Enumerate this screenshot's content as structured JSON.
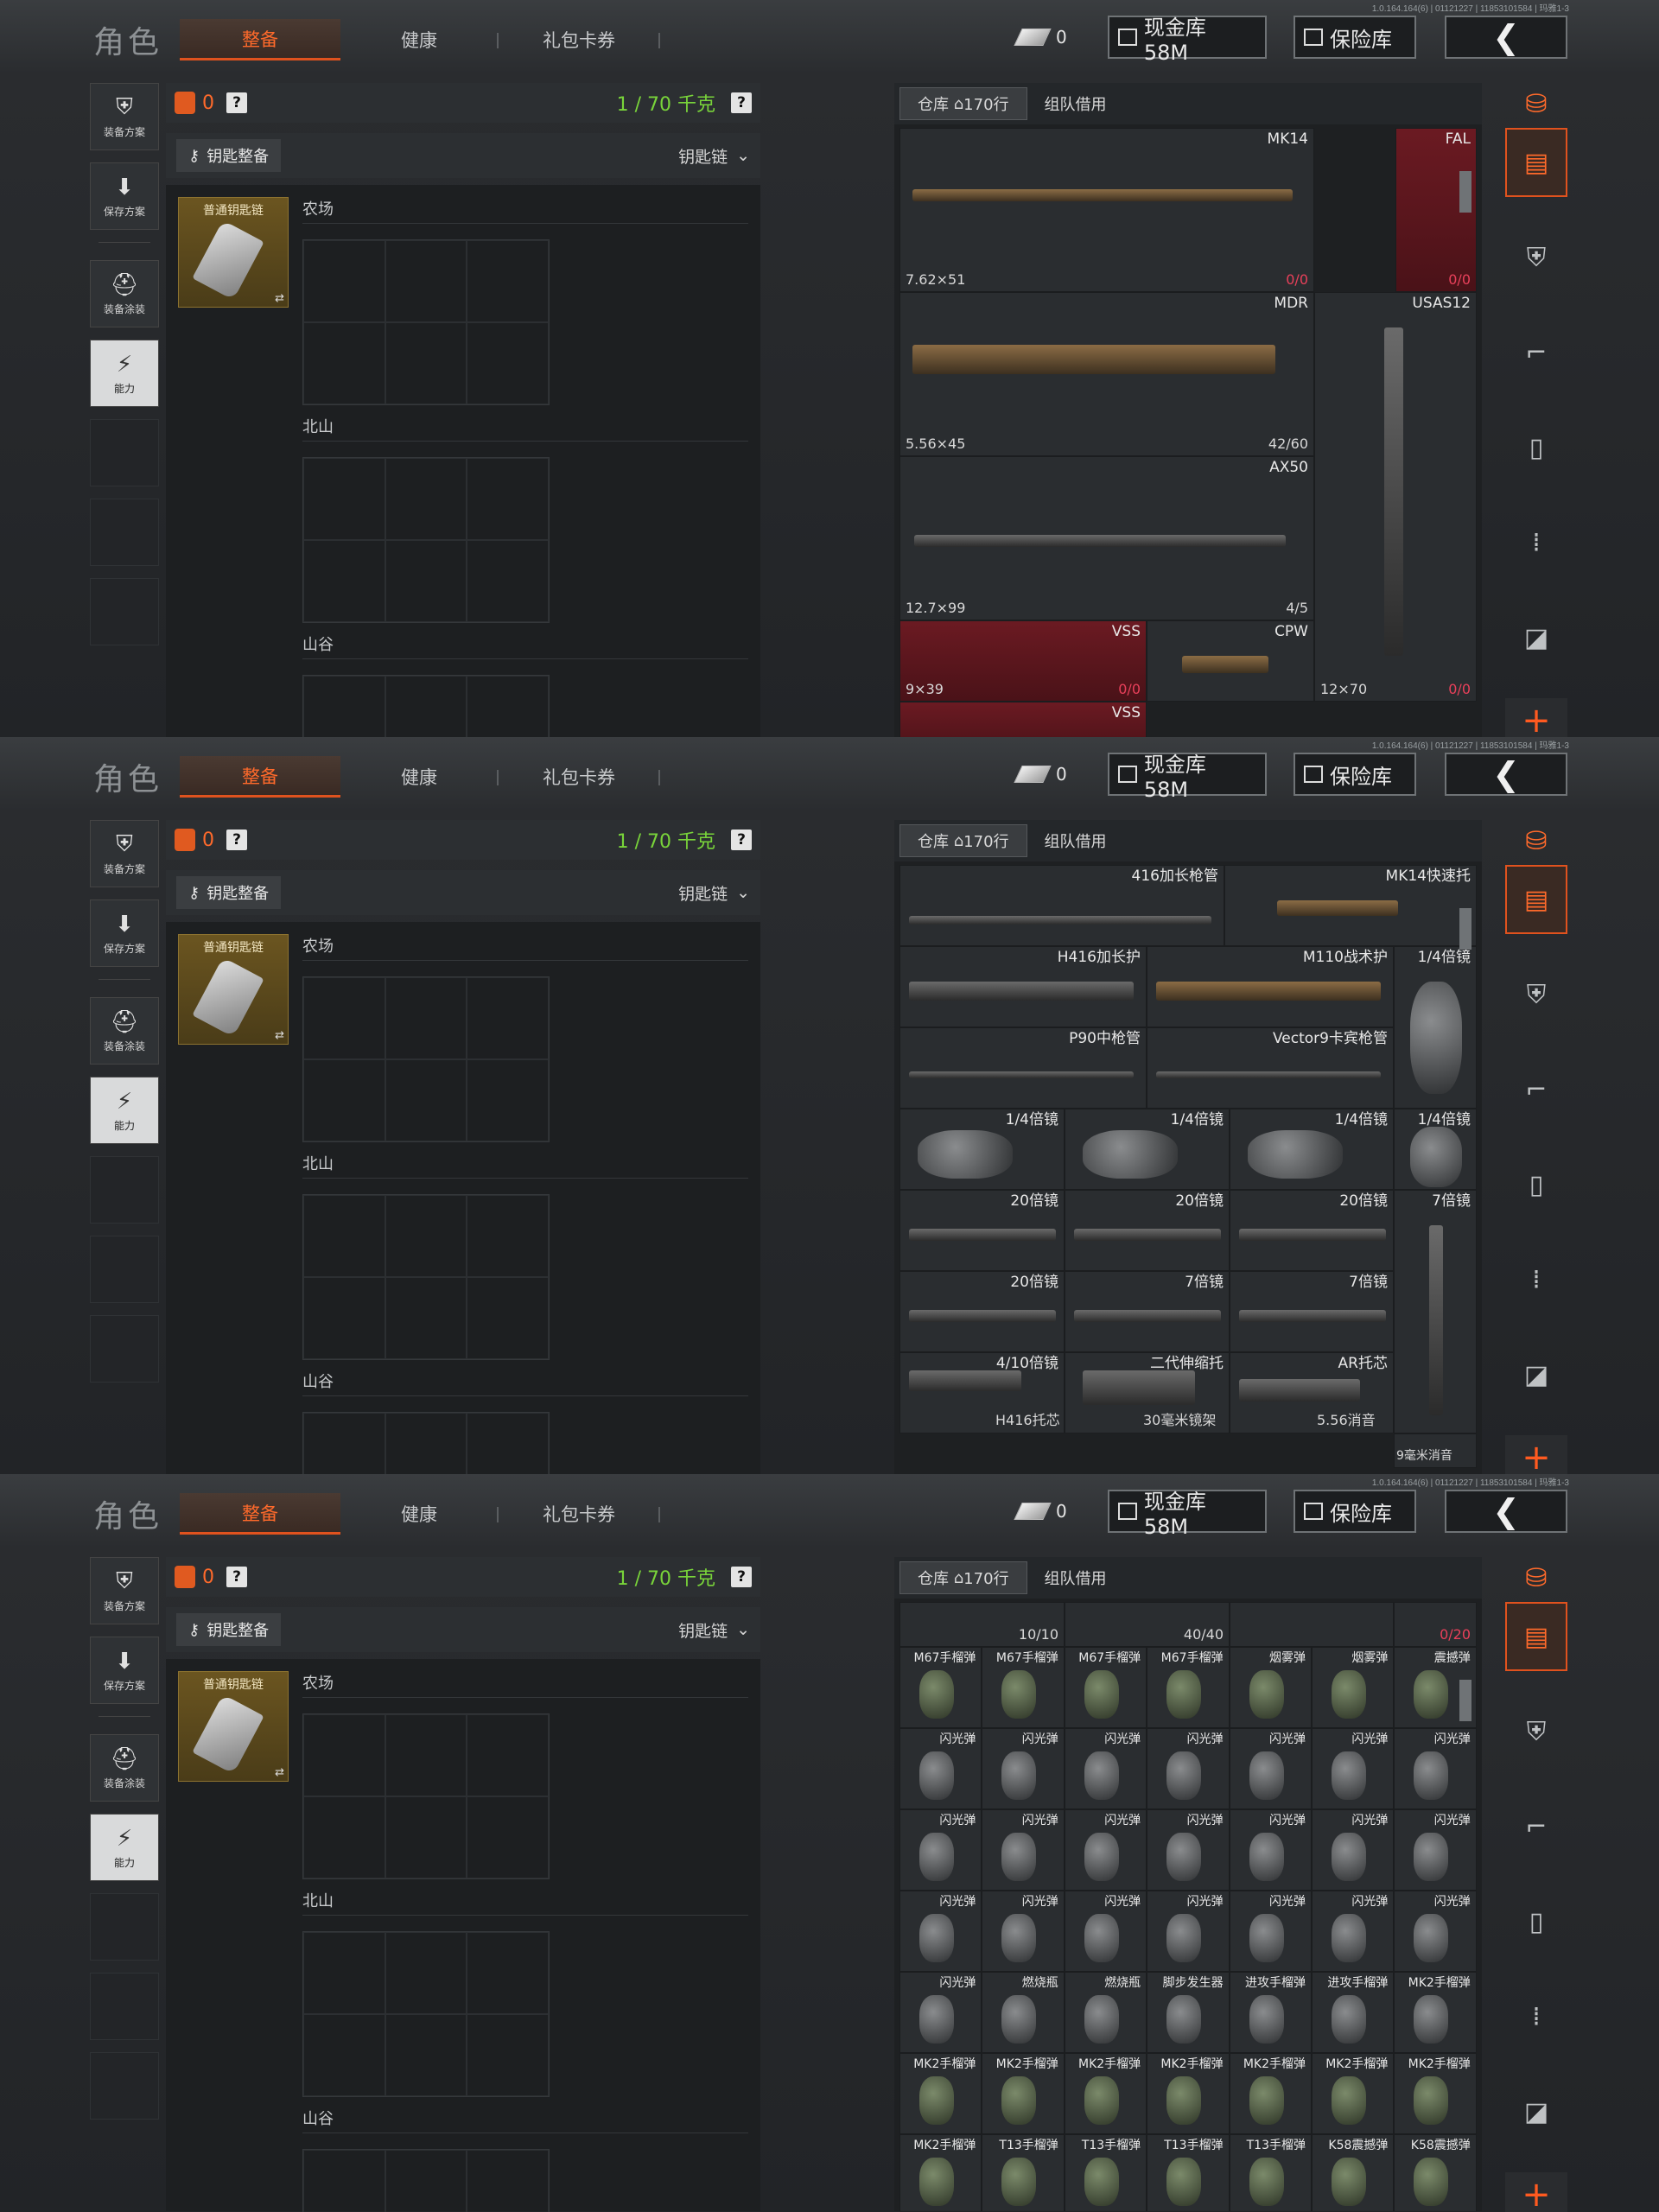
{
  "version": "1.0.164.164(6) | 01121227 | 11853101584 | 玛雅1-3",
  "header": {
    "title": "角色",
    "tabs": [
      "整备",
      "健康",
      "礼包卡券"
    ],
    "coins": "0",
    "cash_button": "现金库 58M",
    "safe_button": "保险库",
    "back_icon": "chevron-left-icon"
  },
  "sidebar": {
    "items": [
      {
        "label": "装备方案",
        "icon": "vest-icon"
      },
      {
        "label": "保存方案",
        "icon": "save-icon"
      },
      {
        "label": "装备涂装",
        "icon": "helmet-icon"
      },
      {
        "label": "能力",
        "icon": "ability-icon"
      }
    ]
  },
  "loadout": {
    "items_count": "0",
    "weight": "1 / 70 千克",
    "key_header": "钥匙整备",
    "key_select": "钥匙链",
    "key_item": "普通钥匙链",
    "regions": [
      "农场",
      "北山",
      "山谷"
    ]
  },
  "stash": {
    "tabs": [
      "仓库 ⌂170行",
      "组队借用"
    ],
    "tab_warehouse": "仓库",
    "tab_rows": "170行",
    "tab_team": "组队借用"
  },
  "screen1": {
    "items": [
      {
        "name": "MK14",
        "caliber": "7.62×51",
        "count": "0/0"
      },
      {
        "name": "FAL",
        "count": "0/0"
      },
      {
        "name": "MDR",
        "caliber": "5.56×45",
        "count": "42/60"
      },
      {
        "name": "USAS12",
        "caliber": "12×70",
        "count": "0/0"
      },
      {
        "name": "AX50",
        "caliber": "12.7×99",
        "count": "4/5"
      },
      {
        "name": "VSS",
        "caliber": "9×39",
        "count": "0/0"
      },
      {
        "name": "CPW"
      },
      {
        "name": "VSS"
      }
    ]
  },
  "screen2": {
    "items": [
      "416加长枪管",
      "MK14快速托",
      "H416加长护",
      "M110战术护",
      "1/4倍镜",
      "P90中枪管",
      "Vector9卡宾枪管",
      "1/4倍镜",
      "1/4倍镜",
      "1/4倍镜",
      "1/4倍镜",
      "20倍镜",
      "20倍镜",
      "20倍镜",
      "20倍镜",
      "7倍镜",
      "7倍镜",
      "7倍镜",
      "4/10倍镜",
      "二代伸缩托",
      "AR托芯",
      "H416托芯",
      "30毫米镜架",
      "5.56消音",
      "9毫米消音"
    ]
  },
  "screen3": {
    "top_counts": [
      "10/10",
      "40/40",
      "0/20"
    ],
    "row1": [
      "M67手榴弹",
      "M67手榴弹",
      "M67手榴弹",
      "M67手榴弹",
      "烟雾弹",
      "烟雾弹",
      "震撼弹"
    ],
    "flash": "闪光弹",
    "row5": [
      "闪光弹",
      "燃烧瓶",
      "燃烧瓶",
      "脚步发生器",
      "进攻手榴弹",
      "进攻手榴弹",
      "MK2手榴弹"
    ],
    "row6": [
      "MK2手榴弹",
      "MK2手榴弹",
      "MK2手榴弹",
      "MK2手榴弹",
      "MK2手榴弹",
      "MK2手榴弹",
      "MK2手榴弹"
    ],
    "row7": [
      "MK2手榴弹",
      "T13手榴弹",
      "T13手榴弹",
      "T13手榴弹",
      "T13手榴弹",
      "K58震撼弹",
      "K58震撼弹"
    ]
  }
}
